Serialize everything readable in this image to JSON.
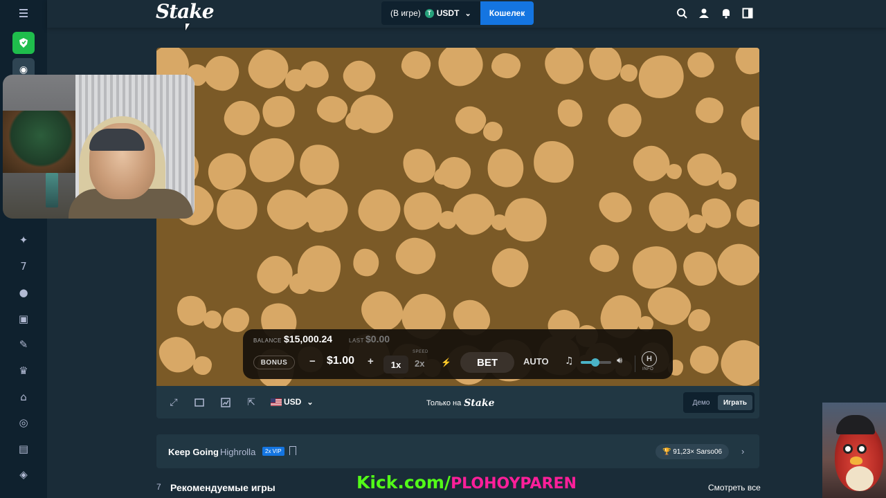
{
  "topbar": {
    "logo": "Stake",
    "wallet_status": "(В игре)",
    "currency": "USDT",
    "wallet_button": "Кошелек",
    "icons": [
      "search-icon",
      "user-icon",
      "bell-icon",
      "sidebar-toggle-icon"
    ]
  },
  "sidebar": {
    "icons": [
      "menu-icon",
      "casino-icon",
      "sports-icon",
      "sparkle-icon",
      "seven-icon",
      "fire-icon",
      "gift-icon",
      "mic-icon",
      "crown-icon",
      "trophy-icon",
      "target-icon",
      "present-icon",
      "shield-icon"
    ]
  },
  "game": {
    "panel": {
      "balance_label": "BALANCE",
      "balance_value": "$15,000.24",
      "last_label": "LAST",
      "last_value": "$0.00",
      "bonus_label": "BONUS",
      "minus": "−",
      "bet_amount": "$1.00",
      "plus": "+",
      "speed_label": "SPEED",
      "speed_1x": "1x",
      "speed_2x": "2x",
      "bet_label": "BET",
      "auto_label": "AUTO",
      "volume_fraction": 0.48,
      "info_symbol": "H",
      "info_label": "INFO"
    }
  },
  "game_footer": {
    "currency": "USD",
    "only_on": "Только на",
    "only_on_brand": "Stake",
    "demo": "Демо",
    "play": "Играть"
  },
  "keep_bar": {
    "title": "Keep Going",
    "subtitle": "Highrolla",
    "vip_badge": "2x VIP",
    "win": "🏆 91,23× Sarso06"
  },
  "recommended": {
    "title": "Рекомендуемые игры",
    "see_all": "Смотреть все"
  },
  "overlay": {
    "kick_prefix": "Kick.com/",
    "kick_channel": "PLOHOYPAREN"
  }
}
